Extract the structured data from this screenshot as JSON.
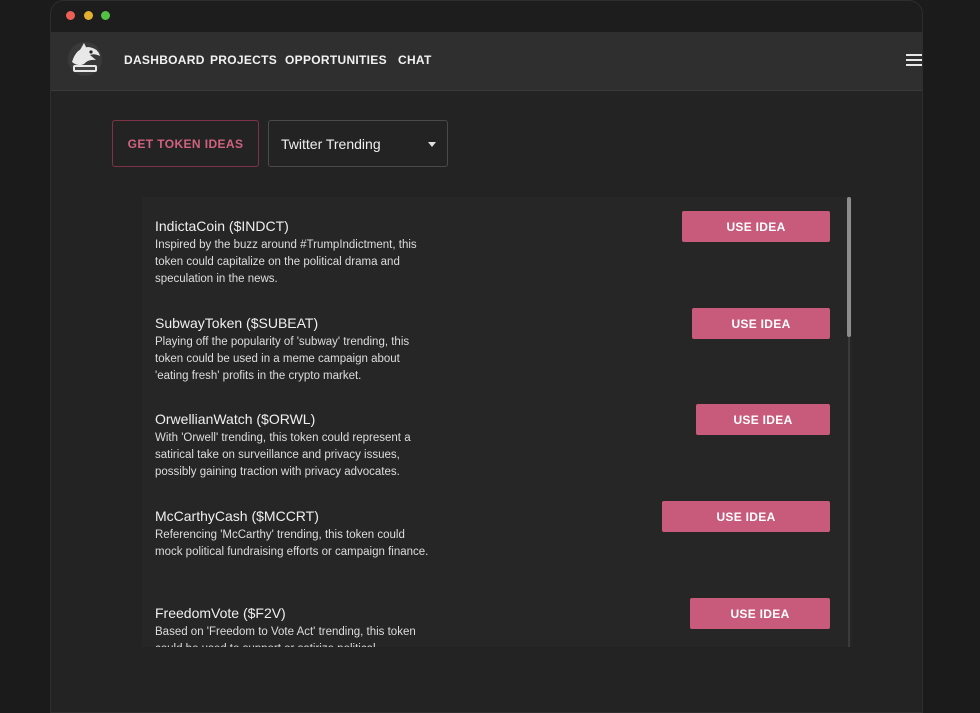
{
  "window": {
    "controls": [
      "close",
      "minimize",
      "maximize"
    ]
  },
  "nav": {
    "logo_icon": "shark-mascot-logo",
    "links": [
      "DASHBOARD",
      "PROJECTS",
      "OPPORTUNITIES",
      "CHAT"
    ],
    "menu_icon": "hamburger-menu-icon"
  },
  "controls": {
    "get_ideas_label": "GET TOKEN IDEAS",
    "source_select_value": "Twitter Trending"
  },
  "ideas": [
    {
      "title": "IndictaCoin ($INDCT)",
      "description": "Inspired by the buzz around #TrumpIndictment, this token could capitalize on the political drama and speculation in the news.",
      "button": "USE IDEA"
    },
    {
      "title": "SubwayToken ($SUBEAT)",
      "description": "Playing off the popularity of 'subway' trending, this token could be used in a meme campaign about 'eating fresh' profits in the crypto market.",
      "button": "USE IDEA"
    },
    {
      "title": "OrwellianWatch ($ORWL)",
      "description": "With 'Orwell' trending, this token could represent a satirical take on surveillance and privacy issues, possibly gaining traction with privacy advocates.",
      "button": "USE IDEA"
    },
    {
      "title": "McCarthyCash ($MCCRT)",
      "description": "Referencing 'McCarthy' trending, this token could mock political fundraising efforts or campaign finance.",
      "button": "USE IDEA"
    },
    {
      "title": "FreedomVote ($F2V)",
      "description": "Based on 'Freedom to Vote Act' trending, this token could be used to support or satirize political",
      "button": "USE IDEA"
    }
  ],
  "colors": {
    "accent": "#c85b7b",
    "background": "#232323",
    "navbar": "#2f2f2f"
  }
}
